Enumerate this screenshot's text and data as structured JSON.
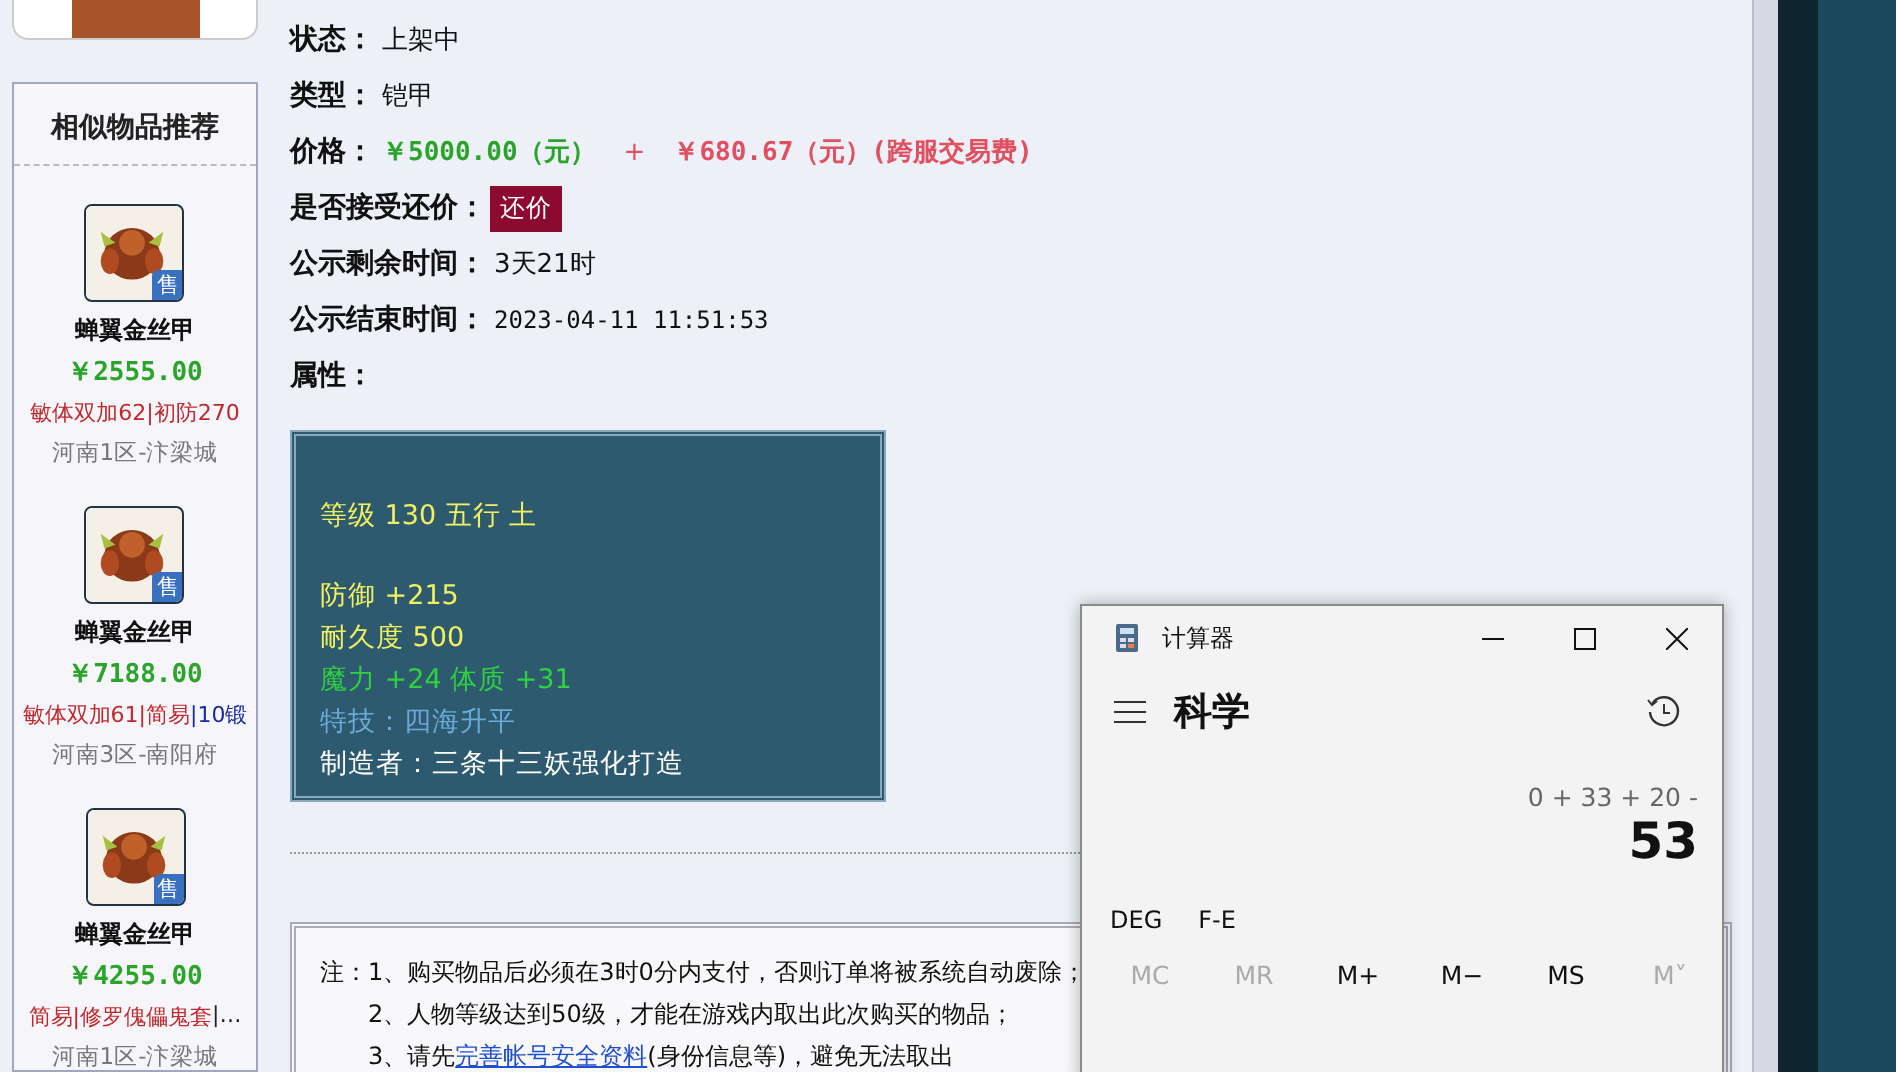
{
  "sidebar": {
    "title": "相似物品推荐",
    "items": [
      {
        "name": "蝉翼金丝甲",
        "badge": "售",
        "price": "￥2555.00",
        "tags": [
          {
            "text": "敏体双加62",
            "color": "#c0282d"
          },
          {
            "text": "|初防270",
            "color": "#c0282d"
          }
        ],
        "server": "河南1区-汴梁城"
      },
      {
        "name": "蝉翼金丝甲",
        "badge": "售",
        "price": "￥7188.00",
        "tags": [
          {
            "text": "敏体双加61",
            "color": "#c0282d"
          },
          {
            "text": "|简易",
            "color": "#c0282d"
          },
          {
            "text": "|10锻",
            "color": "#1a2aa0"
          }
        ],
        "server": "河南3区-南阳府"
      },
      {
        "name": "蝉翼金丝甲",
        "badge": "售",
        "price": "￥4255.00",
        "tags": [
          {
            "text": "简易",
            "color": "#c0282d"
          },
          {
            "text": "|修罗傀儡鬼套",
            "color": "#c0282d"
          },
          {
            "text": "|…",
            "color": "#222222"
          }
        ],
        "server": "河南1区-汴梁城"
      }
    ]
  },
  "details": {
    "status": {
      "label": "状态：",
      "value": "上架中"
    },
    "type": {
      "label": "类型：",
      "value": "铠甲"
    },
    "price": {
      "label": "价格：",
      "base": "￥5000.00（元）",
      "plus": "+",
      "fee": "￥680.67（元）(跨服交易费)"
    },
    "bargain": {
      "label": "是否接受还价：",
      "button": "还价"
    },
    "remaining": {
      "label": "公示剩余时间：",
      "value": "3天21时"
    },
    "end_time": {
      "label": "公示结束时间：",
      "value": "2023-04-11 11:51:53"
    },
    "attributes_label": "属性：",
    "attribute_groups": [
      [
        {
          "text": "等级 130 五行 土",
          "color": "#f0f060"
        }
      ],
      [
        {
          "text": "防御 +215",
          "color": "#f0f060"
        },
        {
          "text": "耐久度 500",
          "color": "#f0f060"
        },
        {
          "text": "魔力 +24 体质 +31",
          "color": "#30d040"
        },
        {
          "text": "特技：四海升平",
          "color": "#6aaad8"
        },
        {
          "text": "制造者：三条十三妖强化打造",
          "color": "#ffffff"
        }
      ]
    ]
  },
  "notes": {
    "label": "注：",
    "items": [
      {
        "before": "1、购买物品后必须在3时0分内支付，否则订单将被系统自动废除；"
      },
      {
        "before": "2、人物等级达到50级，才能在游戏内取出此次购买的物品；"
      },
      {
        "before": "3、请先",
        "link": "完善帐号安全资料",
        "after": "(身份信息等)，避免无法取出"
      }
    ]
  },
  "calculator": {
    "title": "计算器",
    "mode": "科学",
    "expression": "0 + 33 + 20 -",
    "display": "53",
    "angle": "DEG",
    "fe": "F-E",
    "memory": [
      {
        "label": "MC",
        "disabled": true
      },
      {
        "label": "MR",
        "disabled": true
      },
      {
        "label": "M+",
        "disabled": false
      },
      {
        "label": "M−",
        "disabled": false
      },
      {
        "label": "MS",
        "disabled": false
      },
      {
        "label": "M˅",
        "disabled": true
      }
    ]
  }
}
